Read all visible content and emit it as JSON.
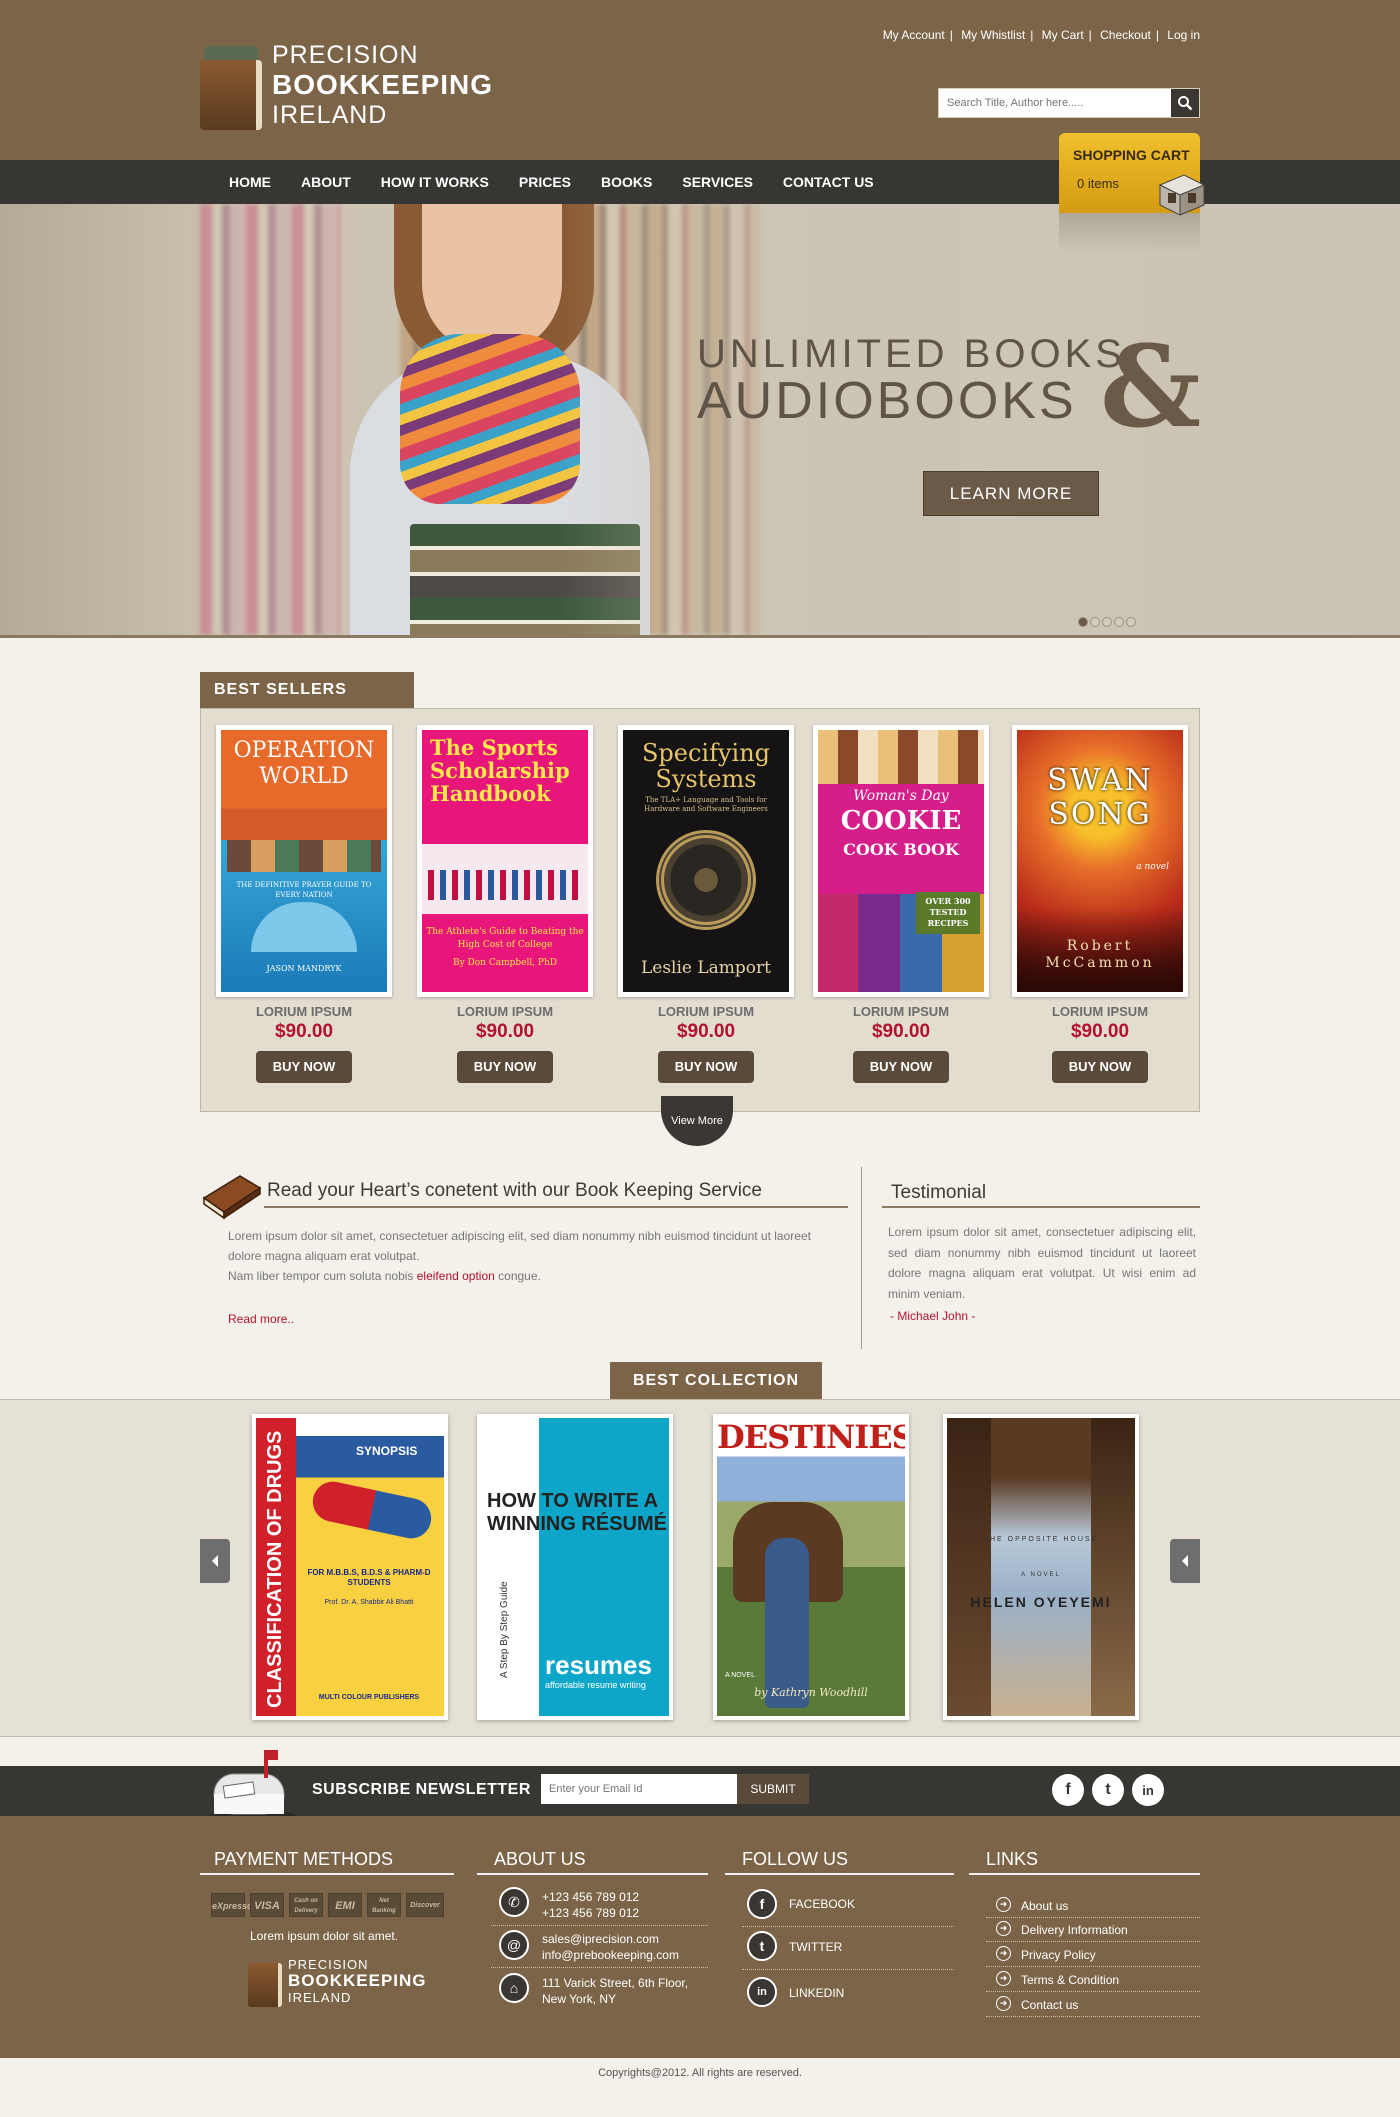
{
  "header": {
    "logo_line1": "PRECISION",
    "logo_line2": "BOOKKEEPING",
    "logo_line3": "IRELAND",
    "top_links": [
      "My Account",
      "My Whistlist",
      "My Cart",
      "Checkout",
      "Log in"
    ],
    "search_placeholder": "Search Title, Author here....."
  },
  "nav": {
    "items": [
      "HOME",
      "ABOUT",
      "HOW IT WORKS",
      "PRICES",
      "BOOKS",
      "SERVICES",
      "CONTACT US"
    ]
  },
  "cart": {
    "title": "SHOPPING CART",
    "count": "0 items"
  },
  "hero": {
    "line1": "UNLIMITED BOOKS",
    "line2": "AUDIOBOOKS",
    "amp": "&",
    "button": "LEARN MORE",
    "slides": 5,
    "active_slide": 1
  },
  "best_sellers": {
    "title": "BEST SELLERS",
    "items": [
      {
        "name": "LORIUM IPSUM",
        "price": "$90.00",
        "buy": "BUY NOW",
        "cover_title": "OPERATION WORLD",
        "cover_sub": "THE DEFINITIVE PRAYER GUIDE TO EVERY NATION",
        "cover_author": "JASON MANDRYK"
      },
      {
        "name": "LORIUM IPSUM",
        "price": "$90.00",
        "buy": "BUY NOW",
        "cover_title": "The Sports Scholarship Handbook",
        "cover_sub": "The Athlete's Guide to Beating the High Cost of College",
        "cover_author": "By Don Campbell, PhD"
      },
      {
        "name": "LORIUM IPSUM",
        "price": "$90.00",
        "buy": "BUY NOW",
        "cover_title": "Specifying Systems",
        "cover_sub": "The TLA+ Language and Tools for Hardware and Software Engineers",
        "cover_author": "Leslie Lamport"
      },
      {
        "name": "LORIUM IPSUM",
        "price": "$90.00",
        "buy": "BUY NOW",
        "cover_title": "COOKIE",
        "cover_top": "Woman's Day",
        "cover_sub": "COOK BOOK",
        "cover_badge": "OVER 300 TESTED RECIPES"
      },
      {
        "name": "LORIUM IPSUM",
        "price": "$90.00",
        "buy": "BUY NOW",
        "cover_title": "SWAN SONG",
        "cover_sub": "a novel",
        "cover_author": "Robert McCammon"
      }
    ],
    "view_more": "View More"
  },
  "read": {
    "title": "Read your Heart’s conetent with our Book Keeping Service",
    "para1": "Lorem ipsum dolor sit amet, consectetuer adipiscing elit, sed diam nonummy nibh euismod tincidunt ut laoreet dolore magna aliquam erat volutpat.",
    "para2_a": "Nam liber tempor cum soluta nobis ",
    "para2_hl": "eleifend option",
    "para2_b": " congue.",
    "read_more": "Read more.."
  },
  "testimonial": {
    "title": "Testimonial",
    "text": "Lorem ipsum dolor sit amet, consectetuer adipiscing elit, sed diam nonummy nibh euismod tincidunt ut laoreet dolore magna aliquam erat volutpat. Ut wisi enim ad minim veniam.",
    "by": "- Michael John -"
  },
  "best_collection": {
    "title": "BEST COLLECTION",
    "items": [
      {
        "cover_title": "CLASSIFICATION OF DRUGS",
        "cover_sub": "SYNOPSIS",
        "cover_for": "FOR M.B.B.S, B.D.S & PHARM-D STUDENTS",
        "cover_author": "Prof. Dr. A. Shabbir Ali Bhatti",
        "cover_pub": "MULTI COLOUR PUBLISHERS"
      },
      {
        "cover_title": "HOW TO WRITE A WINNING RÉSUMÉ",
        "cover_side": "A Step By Step Guide",
        "cover_brand": "resumes",
        "cover_tag": "affordable resume writing"
      },
      {
        "cover_title": "DESTINIES",
        "cover_sub": "A NOVEL",
        "cover_author": "by Kathryn Woodhill"
      },
      {
        "cover_title": "THE OPPOSITE HOUSE",
        "cover_sub": "A NOVEL",
        "cover_author": "HELEN OYEYEMI"
      }
    ]
  },
  "newsletter": {
    "title": "SUBSCRIBE NEWSLETTER",
    "placeholder": "Enter your Email Id",
    "button": "SUBMIT",
    "social": [
      "f",
      "t",
      "in"
    ]
  },
  "footer": {
    "payment_title": "PAYMENT METHODS",
    "payment_cards": [
      "eXpresso",
      "VISA",
      "Cash on Delivery",
      "EMI",
      "Net Banking",
      "Discover"
    ],
    "payment_text": "Lorem ipsum dolor sit amet.",
    "about_title": "ABOUT US",
    "phone1": "+123 456 789 012",
    "phone2": "+123 456 789 012",
    "email1": "sales@iprecision.com",
    "email2": "info@prebookeeping.com",
    "addr1": "111 Varick Street, 6th Floor,",
    "addr2": "New York, NY",
    "follow_title": "FOLLOW US",
    "follow": [
      "FACEBOOK",
      "TWITTER",
      "LINKEDIN"
    ],
    "links_title": "LINKS",
    "links": [
      "About us",
      "Delivery Information",
      "Privacy Policy",
      "Terms & Condition",
      "Contact us"
    ],
    "copyright": "Copyrights@2012. All rights are reserved."
  },
  "colors": {
    "brown": "#7c6448",
    "dark": "#383632",
    "gold": "#e0ad1c",
    "price_red": "#b3122e"
  }
}
